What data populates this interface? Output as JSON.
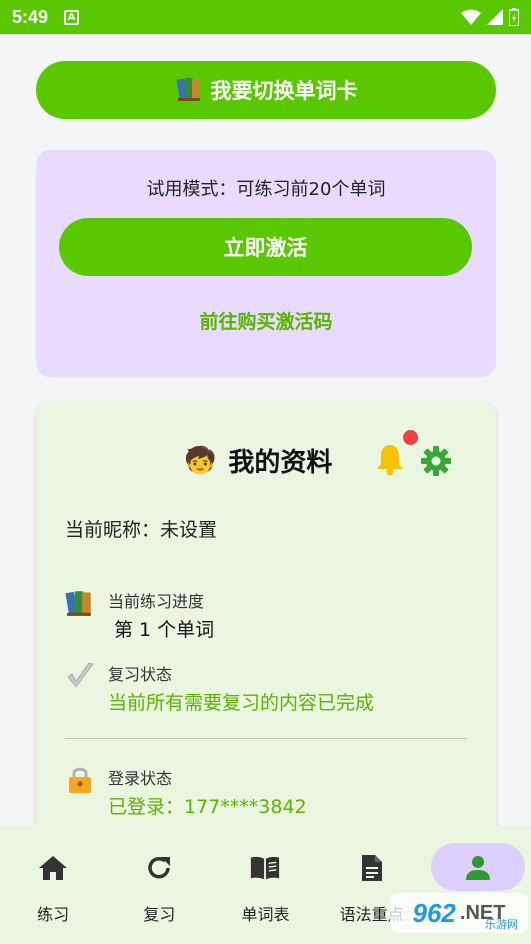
{
  "status_bar": {
    "time": "5:49",
    "notification_icon": "A"
  },
  "switch_card_button": {
    "label": "我要切换单词卡",
    "icon": "books-icon"
  },
  "trial": {
    "text": "试用模式：可练习前20个单词",
    "activate_label": "立即激活",
    "buy_link": "前往购买激活码"
  },
  "profile": {
    "title": "我的资料",
    "avatar": "🧒",
    "nickname": "当前昵称：未设置",
    "progress": {
      "label": "当前练习进度",
      "value": "第 1 个单词"
    },
    "review": {
      "label": "复习状态",
      "value": "当前所有需要复习的内容已完成"
    },
    "login": {
      "label": "登录状态",
      "value": "已登录：177****3842"
    }
  },
  "nav": {
    "items": [
      {
        "label": "练习",
        "icon": "home-icon"
      },
      {
        "label": "复习",
        "icon": "refresh-icon"
      },
      {
        "label": "单词表",
        "icon": "book-open-icon"
      },
      {
        "label": "语法重点",
        "icon": "document-icon"
      },
      {
        "label": "",
        "icon": "person-icon"
      }
    ]
  },
  "watermark": {
    "number": "962",
    "suffix": ".NET",
    "cn": "乐游网"
  },
  "colors": {
    "accent": "#5ac800",
    "trial_bg": "#e8dbff",
    "profile_bg": "#eaf6e0",
    "link_green": "#5ab400"
  }
}
